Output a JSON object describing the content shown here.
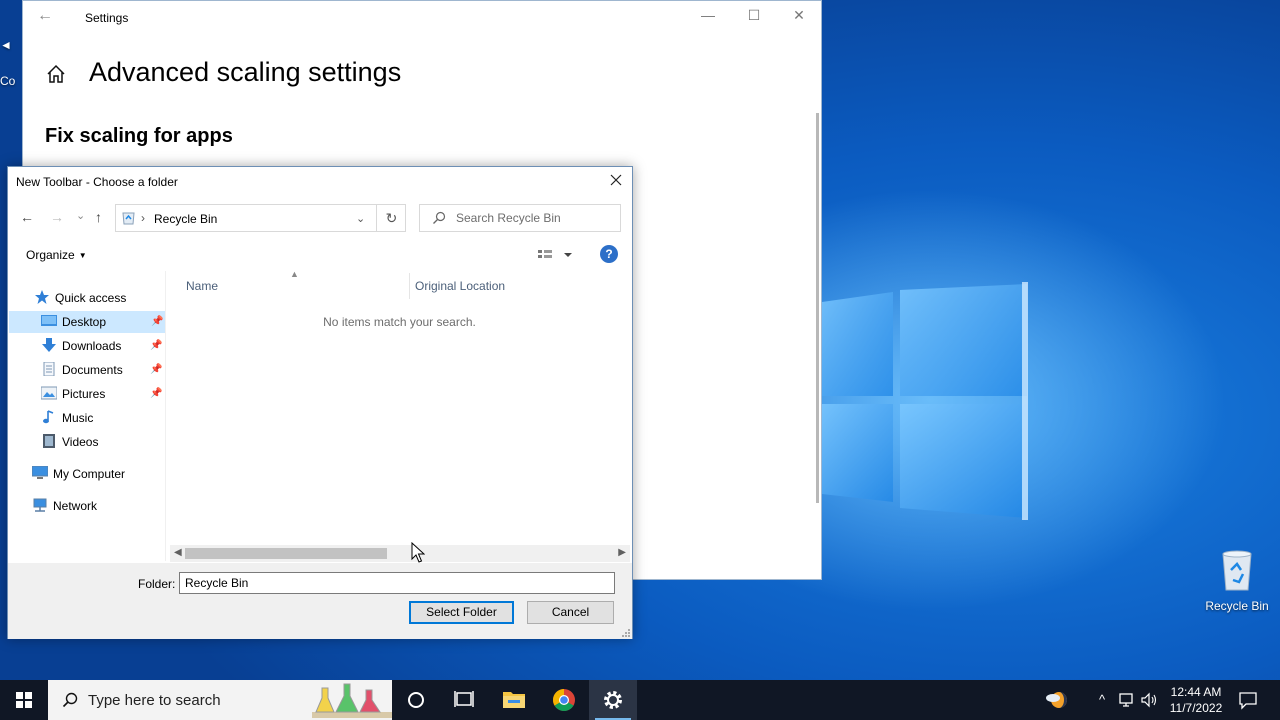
{
  "desktop": {
    "recycle_bin_label": "Recycle Bin",
    "left_peek_top": "◄",
    "left_peek_label": "Co"
  },
  "settings": {
    "app_title": "Settings",
    "back_glyph": "←",
    "minimize_glyph": "—",
    "maximize_glyph": "☐",
    "close_glyph": "✕",
    "page_title": "Advanced scaling settings",
    "section_title": "Fix scaling for apps"
  },
  "dialog": {
    "title": "New Toolbar - Choose a folder",
    "nav": {
      "back": "←",
      "forward": "→",
      "recent": "⌄",
      "up": "↑"
    },
    "address": {
      "separator": "›",
      "location": "Recycle Bin",
      "dropdown": "⌄",
      "refresh": "↻"
    },
    "search": {
      "placeholder": "Search Recycle Bin"
    },
    "toolbar": {
      "organize": "Organize",
      "help": "?"
    },
    "nav_pane": {
      "quick_access": "Quick access",
      "items": [
        {
          "label": "Desktop",
          "pinned": true,
          "selected": true
        },
        {
          "label": "Downloads",
          "pinned": true
        },
        {
          "label": "Documents",
          "pinned": true
        },
        {
          "label": "Pictures",
          "pinned": true
        },
        {
          "label": "Music",
          "pinned": false
        },
        {
          "label": "Videos",
          "pinned": false
        }
      ],
      "my_computer": "My Computer",
      "network": "Network"
    },
    "columns": [
      "Name",
      "Original Location"
    ],
    "empty_message": "No items match your search.",
    "scroll": {
      "left": "◀",
      "right": "▶"
    },
    "footer": {
      "folder_label": "Folder:",
      "folder_value": "Recycle Bin",
      "select_button": "Select Folder",
      "cancel_button": "Cancel"
    }
  },
  "taskbar": {
    "search_placeholder": "Type here to search",
    "tray": {
      "chevron": "^",
      "network": "▭",
      "volume": "🔈"
    },
    "time": "12:44 AM",
    "date": "11/7/2022"
  },
  "colors": {
    "accent": "#0078d7",
    "selection": "#cce8ff",
    "taskbar": "#101725",
    "help_button": "#2c6fc8"
  }
}
